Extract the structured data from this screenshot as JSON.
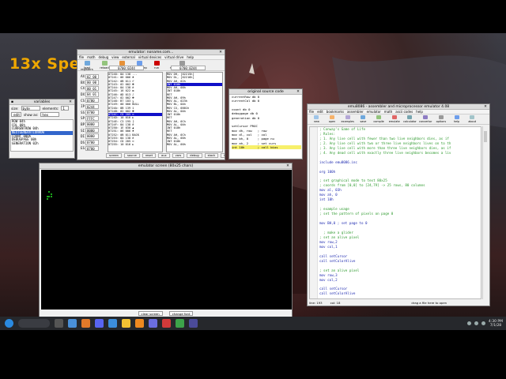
{
  "overlay": {
    "speed_label": "13x Speed"
  },
  "variables": {
    "title": "variables",
    "size_label": "size:",
    "size_value": "byte",
    "elements_label": "elements:",
    "elements_value": "1",
    "edit_btn": "edit",
    "show_as_label": "show as:",
    "show_as_value": "hex",
    "items": [
      "ROW   04h",
      "COL   00h",
      "CURRENTROW     04h",
      "NEXTGENERATIONROW",
      "COUNT          000h",
      "DEBUGPAGE 00h",
      "GENERATION      02h"
    ],
    "selected_index": 3
  },
  "emu": {
    "title": "emulator: noname.com...",
    "menu": [
      "file",
      "math",
      "debug",
      "view",
      "external",
      "virtual devices",
      "virtual drive",
      "help"
    ],
    "toolbar": [
      "load",
      "reload",
      "step back",
      "single step",
      "run",
      "step delay ms: 0"
    ],
    "registers_label": "registers",
    "addr_left": "0700:0244",
    "addr_right": "0700:0244",
    "regs": [
      [
        "AX",
        "02",
        "00"
      ],
      [
        "BX",
        "00",
        "00"
      ],
      [
        "CX",
        "00",
        "01"
      ],
      [
        "DX",
        "04",
        "01"
      ],
      [
        "CS",
        "0700",
        ""
      ],
      [
        "IP",
        "0244",
        ""
      ],
      [
        "SS",
        "0700",
        ""
      ],
      [
        "SP",
        "FFFC",
        ""
      ],
      [
        "BP",
        "0000",
        ""
      ],
      [
        "SI",
        "0000",
        ""
      ],
      [
        "DI",
        "0000",
        ""
      ],
      [
        "DS",
        "0700",
        ""
      ],
      [
        "ES",
        "0700",
        ""
      ]
    ],
    "hex_lines": [
      "07240: 8A 138 ...",
      "07241: 06 006 ♠",
      "07242: 0B 011 ♂",
      "07243: 02 002 ☻",
      "07244: 8A 138 è",
      "07245: 16 022 ▬",
      "07246: 0D 013 ♪",
      "07247: 02 002 ☻",
      "07248: B7 183 ╖",
      "07249: 00 000 NULL",
      "0724A: 8B 139 ï",
      "0724B: 02 002 ☻",
      "0724C: CD 205 ═",
      "0724D: 10 016 ►",
      "0724E: C3 195 ├",
      "0724F: 8A 138 è",
      "07250: 1E 030 ▲",
      "07251: 06 006 ♠",
      "07252: 0B 011 BACK",
      "07253: 8A 138 è",
      "07254: CD 205 ═",
      "07255: 10 016 ►"
    ],
    "hex_selected": 12,
    "dis_lines": [
      "MOV DH, [02215h]",
      "MOV DL, [02216h]",
      "MOV AH, 02h",
      "INT 010h",
      "MOV AH, 08h",
      "INT 010h",
      "RET",
      "MOV AH, 09h",
      "MOV AL, 023h",
      "MOV BL, 0Ah",
      "MOV CX, 0001h",
      "MOV AL, 0Ah",
      "INT 010h",
      "RET",
      "MOV AH, 0Ch",
      "MOV AL, 0Ah",
      "INT 010h",
      "RET",
      "MOV AH, 0Ch",
      "MOV AL, 00h",
      "INT 010h",
      "MOV AL, 00h"
    ],
    "dis_selected": 3,
    "bottom_btns": [
      "screen",
      "source",
      "reset",
      "aux",
      "vars",
      "debug",
      "stack",
      "flags"
    ]
  },
  "screen": {
    "title": "emulator screen (80x25 chars)",
    "btn_clear": "clear screen",
    "btn_change": "change font"
  },
  "source": {
    "title": "original source code",
    "lines": [
      "currentRow db 0",
      "currentCol db 0",
      "",
      "count db 0",
      "debugpage db 0",
      "generation db 0",
      "",
      "setCursor PROC",
      "mov dh, row   ; row",
      "mov dl, col   ; col",
      "mov bh, 0     ; page nu",
      "mov ah, 2     ; set curs",
      "int 10h       ; call bios"
    ],
    "highlight": 12
  },
  "editor": {
    "title": "emu8086 - assembler and microprocessor emulator 4.08",
    "menu": [
      "file",
      "edit",
      "bookmarks",
      "assembler",
      "emulator",
      "math",
      "ascii codes",
      "help"
    ],
    "toolbar": [
      "new",
      "open",
      "examples",
      "save",
      "compile",
      "emulate",
      "calculator",
      "convertor",
      "options",
      "help",
      "about"
    ],
    "lines": [
      {
        "n": "1",
        "t": "; Conway's Game of Life",
        "c": "c"
      },
      {
        "n": "2",
        "t": "; Rules:",
        "c": "c"
      },
      {
        "n": "3",
        "t": "; 1. Any live cell with fewer than two live neighbors dies, as if",
        "c": "c"
      },
      {
        "n": "4",
        "t": "; 2. Any live cell with two or three live neighbors lives on to th",
        "c": "c"
      },
      {
        "n": "5",
        "t": "; 3. Any live cell with more than three live neighbors dies, as if",
        "c": "c"
      },
      {
        "n": "6",
        "t": "; 4. Any dead cell with exactly three live neighbors becomes a liv",
        "c": "c"
      },
      {
        "n": "7",
        "t": "",
        "c": ""
      },
      {
        "n": "8",
        "t": "include emu8086.inc",
        "c": "k"
      },
      {
        "n": "9",
        "t": "",
        "c": ""
      },
      {
        "n": "10",
        "t": "org 100h",
        "c": "k"
      },
      {
        "n": "11",
        "t": "",
        "c": ""
      },
      {
        "n": "12",
        "t": "; set graphical mode to text 80x25",
        "c": "c"
      },
      {
        "n": "13",
        "t": "; coords from [0,0] to [24,79] -> 25 rows, 80 columns",
        "c": "c"
      },
      {
        "n": "14",
        "t": "mov al, 03h",
        "c": "k"
      },
      {
        "n": "15",
        "t": "mov ah, 0",
        "c": "k"
      },
      {
        "n": "16",
        "t": "int 10h",
        "c": "k"
      },
      {
        "n": "17",
        "t": "",
        "c": ""
      },
      {
        "n": "18",
        "t": "; example usage",
        "c": "c"
      },
      {
        "n": "19",
        "t": "; set the pattern of pixels on page 0",
        "c": "c"
      },
      {
        "n": "20",
        "t": "",
        "c": ""
      },
      {
        "n": "21",
        "t": "mov BH,0 ; set page to 0",
        "c": "k"
      },
      {
        "n": "22",
        "t": "",
        "c": ""
      },
      {
        "n": "23",
        "t": "  ; make a glider",
        "c": "c"
      },
      {
        "n": "24",
        "t": "; set an alive pixel",
        "c": "c"
      },
      {
        "n": "25",
        "t": "mov row,2",
        "c": "k"
      },
      {
        "n": "26",
        "t": "mov col,1",
        "c": "k"
      },
      {
        "n": "27",
        "t": "",
        "c": ""
      },
      {
        "n": "28",
        "t": "call setCursor",
        "c": "k"
      },
      {
        "n": "29",
        "t": "call setColorAlive",
        "c": "k"
      },
      {
        "n": "30",
        "t": "",
        "c": ""
      },
      {
        "n": "31",
        "t": "; set an alive pixel",
        "c": "c"
      },
      {
        "n": "32",
        "t": "mov row,3",
        "c": "k"
      },
      {
        "n": "33",
        "t": "mov col,2",
        "c": "k"
      },
      {
        "n": "34",
        "t": "",
        "c": ""
      },
      {
        "n": "35",
        "t": "call setCursor",
        "c": "k"
      },
      {
        "n": "36",
        "t": "call setColorAlive",
        "c": "k"
      },
      {
        "n": "37",
        "t": "",
        "c": ""
      },
      {
        "n": "38",
        "t": "; set an alive pixel",
        "c": "c"
      }
    ],
    "status_line": "line: 193",
    "status_col": "col: 18",
    "status_hint": "drag a file here to open"
  },
  "tray": {
    "time": "4:30 PM",
    "date": "7/1/28"
  },
  "colors": {
    "comment": "#2e9a2e",
    "code": "#1f2bb0",
    "accent": "#f0a800",
    "selection": "#1010c8"
  }
}
